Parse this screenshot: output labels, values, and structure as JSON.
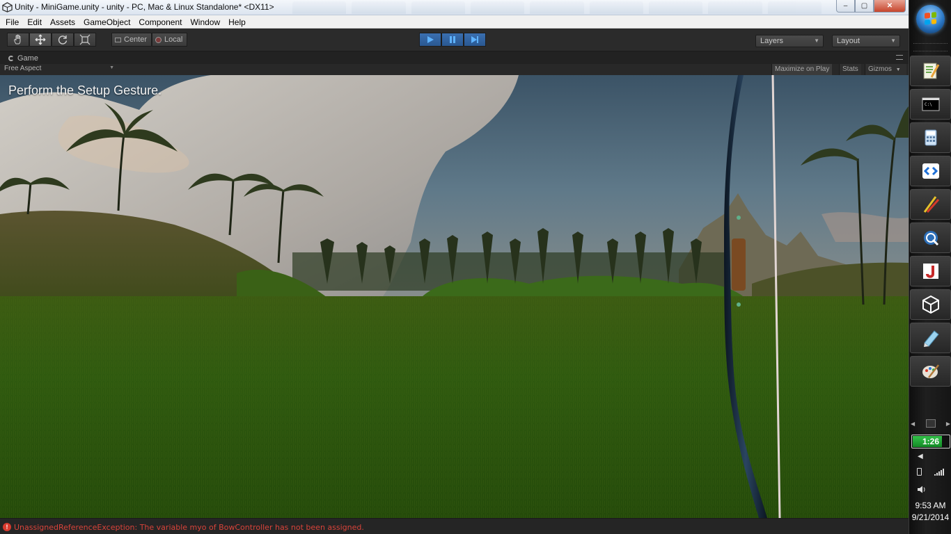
{
  "window": {
    "title": "Unity - MiniGame.unity - unity - PC, Mac & Linux Standalone* <DX11>",
    "minimize": "–",
    "maximize": "▢",
    "close": "✕"
  },
  "menu": [
    "File",
    "Edit",
    "Assets",
    "GameObject",
    "Component",
    "Window",
    "Help"
  ],
  "toolbar": {
    "tools": [
      "hand-icon",
      "move-icon",
      "rotate-icon",
      "scale-icon"
    ],
    "active_tool": "move-icon",
    "pivot_mode": "Center",
    "pivot_rotation": "Local",
    "play_state": "playing",
    "layers_label": "Layers",
    "layout_label": "Layout"
  },
  "game_panel": {
    "tab_label": "Game",
    "aspect": "Free Aspect",
    "maximize_on_play": "Maximize on Play",
    "stats": "Stats",
    "gizmos": "Gizmos",
    "gui_message": "Perform the Setup Gesture."
  },
  "console": {
    "error_message": "UnassignedReferenceException: The variable myo of BowController has not been assigned."
  },
  "taskbar": {
    "apps": [
      "notepad-plus-icon",
      "cmd-icon",
      "calculator-icon",
      "code-editor-icon",
      "paint-tools-icon",
      "remote-desktop-icon",
      "java-icon",
      "unity-icon",
      "notes-icon",
      "paint-icon"
    ],
    "battery_text": "1:26",
    "battery_level": 0.82,
    "time": "9:53 AM",
    "date": "9/21/2014",
    "colors": {
      "accent_blue": "#2a5891",
      "error_red": "#d8433a",
      "battery_green": "#34c24a"
    }
  }
}
